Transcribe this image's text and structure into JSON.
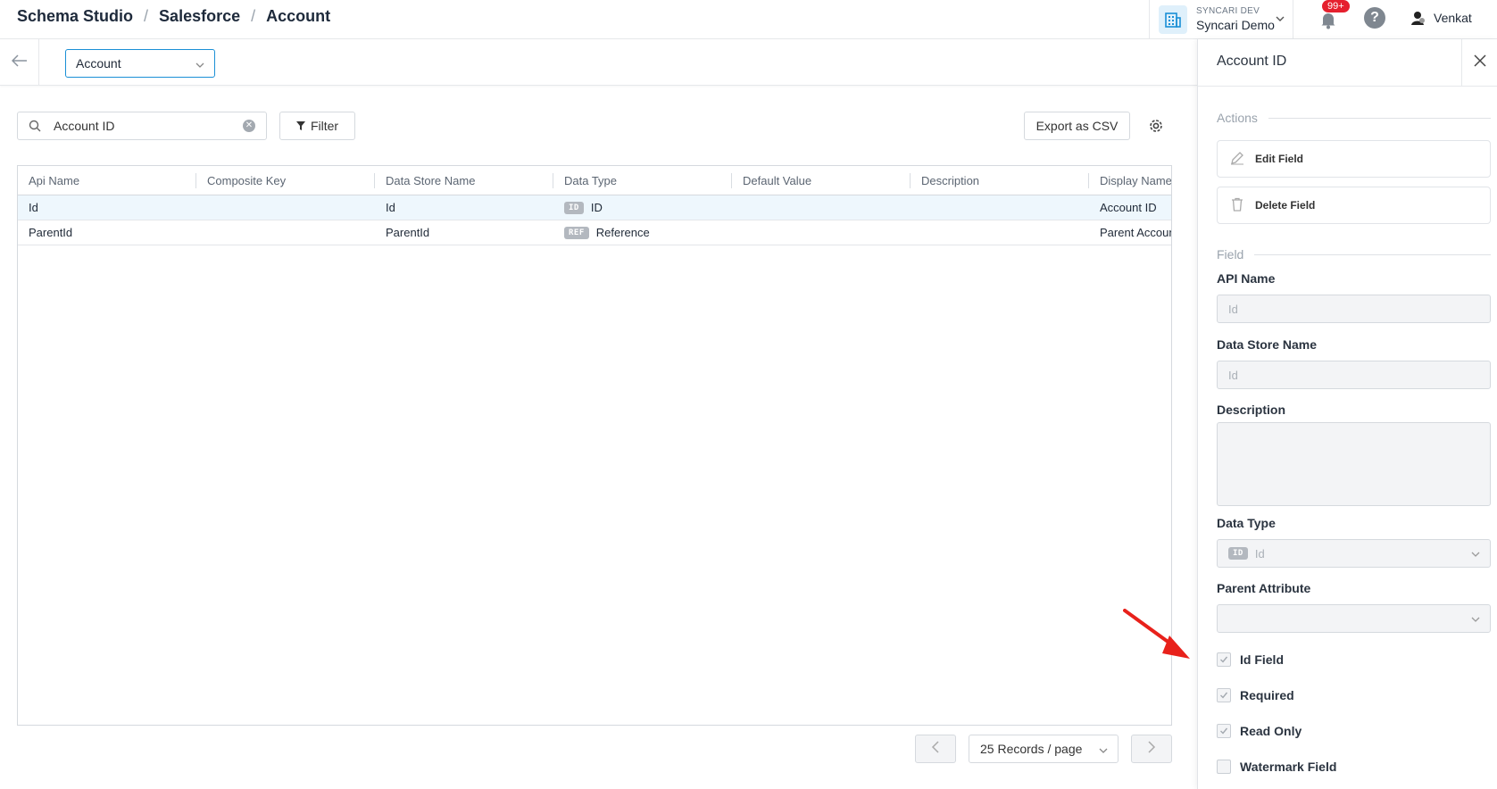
{
  "breadcrumb": [
    "Schema Studio",
    "Salesforce",
    "Account"
  ],
  "org": {
    "env": "SYNCARI DEV",
    "name": "Syncari Demo"
  },
  "notifications": {
    "badge": "99+"
  },
  "help": {
    "glyph": "?"
  },
  "user": {
    "name": "Venkat"
  },
  "entity_select": {
    "value": "Account"
  },
  "search": {
    "value": "Account ID"
  },
  "toolbar": {
    "filter_label": "Filter",
    "export_label": "Export as CSV"
  },
  "table": {
    "columns": [
      "Api Name",
      "Composite Key",
      "Data Store Name",
      "Data Type",
      "Default Value",
      "Description",
      "Display Name"
    ],
    "rows": [
      {
        "api_name": "Id",
        "composite_key": "",
        "data_store_name": "Id",
        "type_tag": "ID",
        "data_type": "ID",
        "default_value": "",
        "description": "",
        "display_name": "Account ID"
      },
      {
        "api_name": "ParentId",
        "composite_key": "",
        "data_store_name": "ParentId",
        "type_tag": "REF",
        "data_type": "Reference",
        "default_value": "",
        "description": "",
        "display_name": "Parent Account ID"
      }
    ]
  },
  "pagination": {
    "page_size": "25 Records / page"
  },
  "panel": {
    "title": "Account ID",
    "actions_label": "Actions",
    "edit_label": "Edit Field",
    "delete_label": "Delete Field",
    "field_label": "Field",
    "api_name_label": "API Name",
    "api_name_value": "Id",
    "data_store_label": "Data Store Name",
    "data_store_value": "Id",
    "description_label": "Description",
    "data_type_label": "Data Type",
    "data_type_tag": "ID",
    "data_type_value": "Id",
    "parent_attr_label": "Parent Attribute",
    "checkboxes": [
      {
        "label": "Id Field",
        "checked": true
      },
      {
        "label": "Required",
        "checked": true
      },
      {
        "label": "Read Only",
        "checked": true
      },
      {
        "label": "Watermark Field",
        "checked": false
      }
    ]
  },
  "colors": {
    "accent": "#1a8fd6",
    "badge": "#e5202e",
    "arrow": "#e8211b",
    "selected_row": "#eef7fd"
  }
}
